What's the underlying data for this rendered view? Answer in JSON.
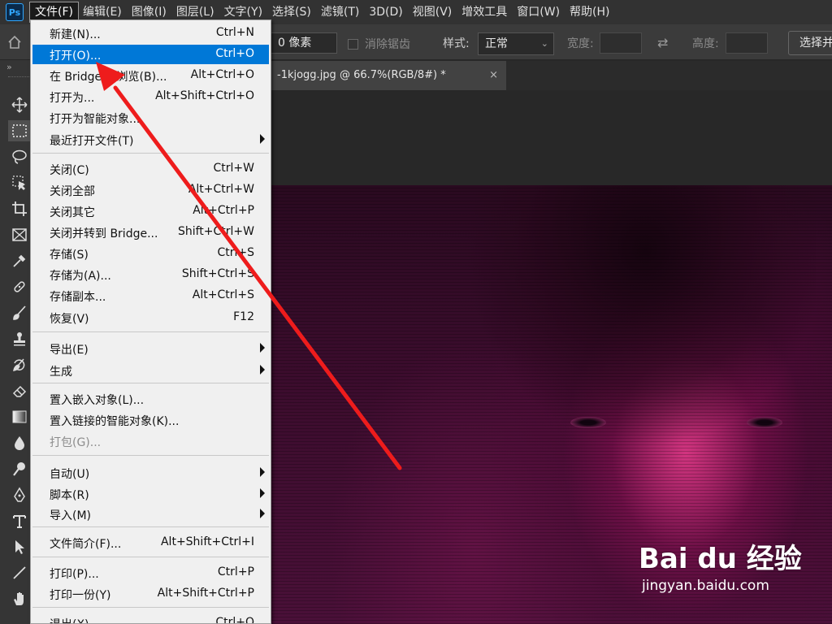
{
  "menubar": {
    "logo": "Ps",
    "items": [
      "文件(F)",
      "编辑(E)",
      "图像(I)",
      "图层(L)",
      "文字(Y)",
      "选择(S)",
      "滤镜(T)",
      "3D(D)",
      "视图(V)",
      "增效工具",
      "窗口(W)",
      "帮助(H)"
    ]
  },
  "options": {
    "feather_value": "0 像素",
    "antialias_label": "消除锯齿",
    "style_label": "样式:",
    "style_value": "正常",
    "width_label": "宽度:",
    "height_label": "高度:",
    "select_button": "选择并"
  },
  "document": {
    "tab_title": "-1kjogg.jpg @ 66.7%(RGB/8#) *",
    "close_glyph": "×"
  },
  "file_menu": {
    "items": [
      {
        "label": "新建(N)...",
        "shortcut": "Ctrl+N"
      },
      {
        "label": "打开(O)...",
        "shortcut": "Ctrl+O",
        "highlighted": true
      },
      {
        "label": "在 Bridge 中浏览(B)...",
        "shortcut": "Alt+Ctrl+O"
      },
      {
        "label": "打开为...",
        "shortcut": "Alt+Shift+Ctrl+O"
      },
      {
        "label": "打开为智能对象...",
        "shortcut": ""
      },
      {
        "label": "最近打开文件(T)",
        "shortcut": "",
        "submenu": true
      },
      {
        "label": "关闭(C)",
        "shortcut": "Ctrl+W"
      },
      {
        "label": "关闭全部",
        "shortcut": "Alt+Ctrl+W"
      },
      {
        "label": "关闭其它",
        "shortcut": "Alt+Ctrl+P"
      },
      {
        "label": "关闭并转到 Bridge...",
        "shortcut": "Shift+Ctrl+W"
      },
      {
        "label": "存储(S)",
        "shortcut": "Ctrl+S"
      },
      {
        "label": "存储为(A)...",
        "shortcut": "Shift+Ctrl+S"
      },
      {
        "label": "存储副本...",
        "shortcut": "Alt+Ctrl+S"
      },
      {
        "label": "恢复(V)",
        "shortcut": "F12"
      },
      {
        "label": "导出(E)",
        "shortcut": "",
        "submenu": true
      },
      {
        "label": "生成",
        "shortcut": "",
        "submenu": true
      },
      {
        "label": "置入嵌入对象(L)...",
        "shortcut": ""
      },
      {
        "label": "置入链接的智能对象(K)...",
        "shortcut": ""
      },
      {
        "label": "打包(G)...",
        "shortcut": "",
        "disabled": true
      },
      {
        "label": "自动(U)",
        "shortcut": "",
        "submenu": true
      },
      {
        "label": "脚本(R)",
        "shortcut": "",
        "submenu": true
      },
      {
        "label": "导入(M)",
        "shortcut": "",
        "submenu": true
      },
      {
        "label": "文件简介(F)...",
        "shortcut": "Alt+Shift+Ctrl+I"
      },
      {
        "label": "打印(P)...",
        "shortcut": "Ctrl+P"
      },
      {
        "label": "打印一份(Y)",
        "shortcut": "Alt+Shift+Ctrl+P"
      },
      {
        "label": "退出(X)",
        "shortcut": "Ctrl+Q"
      }
    ]
  },
  "watermark": {
    "logo": "Bai du 经验",
    "site": "jingyan.baidu.com"
  },
  "colors": {
    "highlight": "#0078d7",
    "arrow": "#ee1c1c",
    "ps_blue": "#31a8ff"
  }
}
